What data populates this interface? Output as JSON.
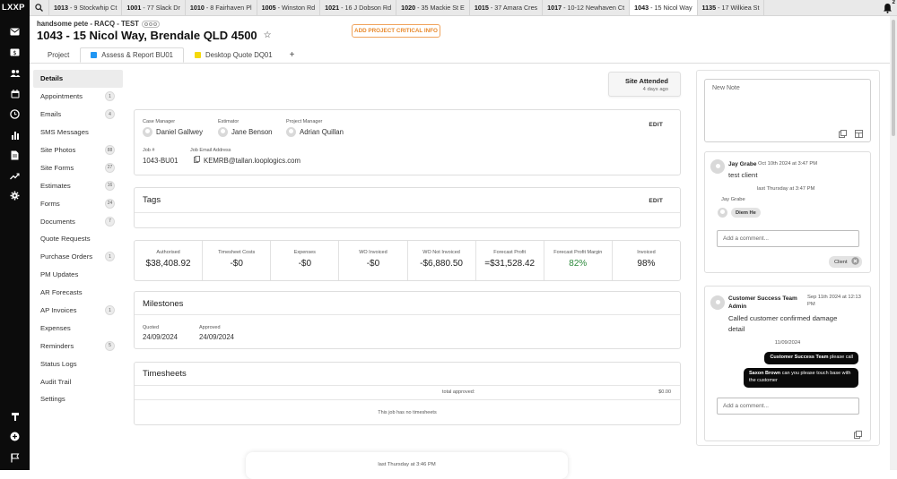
{
  "app": {
    "logo": "LXXP"
  },
  "open_tabs": [
    {
      "num": "1013",
      "label": "- 9 Stockwhip Ct",
      "active": false
    },
    {
      "num": "1001",
      "label": "- 77 Slack Dr",
      "active": false
    },
    {
      "num": "1010",
      "label": "- 8 Fairhaven Pl",
      "active": false
    },
    {
      "num": "1005",
      "label": "- Winston Rd",
      "active": false
    },
    {
      "num": "1021",
      "label": "- 16 J Dobson Rd",
      "active": false
    },
    {
      "num": "1020",
      "label": "- 35 Mackie St E",
      "active": false
    },
    {
      "num": "1015",
      "label": "- 37 Amara Cres",
      "active": false
    },
    {
      "num": "1017",
      "label": "- 10-12 Newhaven Ct",
      "active": false
    },
    {
      "num": "1043",
      "label": "- 15 Nicol Way",
      "active": true
    },
    {
      "num": "1135",
      "label": "- 17 Wilkiea St",
      "active": false
    }
  ],
  "notifications": {
    "count": "2"
  },
  "header": {
    "client": "handsome pete - RACQ - TEST",
    "title": "1043 - 15 Nicol Way, Brendale QLD 4500",
    "critical_button": "ADD PROJECT CRITICAL INFO"
  },
  "subtabs": [
    {
      "label": "Project",
      "color": ""
    },
    {
      "label": "Assess & Report BU01",
      "color": "#2196f3"
    },
    {
      "label": "Desktop Quote DQ01",
      "color": "#f5d90a"
    }
  ],
  "subtab_add": "+",
  "sidenav": [
    {
      "label": "Details",
      "count": ""
    },
    {
      "label": "Appointments",
      "count": "1"
    },
    {
      "label": "Emails",
      "count": "4"
    },
    {
      "label": "SMS Messages",
      "count": ""
    },
    {
      "label": "Site Photos",
      "count": "88"
    },
    {
      "label": "Site Forms",
      "count": "27"
    },
    {
      "label": "Estimates",
      "count": "16"
    },
    {
      "label": "Forms",
      "count": "24"
    },
    {
      "label": "Documents",
      "count": "7"
    },
    {
      "label": "Quote Requests",
      "count": ""
    },
    {
      "label": "Purchase Orders",
      "count": "1"
    },
    {
      "label": "PM Updates",
      "count": ""
    },
    {
      "label": "AR Forecasts",
      "count": ""
    },
    {
      "label": "AP Invoices",
      "count": "1"
    },
    {
      "label": "Expenses",
      "count": ""
    },
    {
      "label": "Reminders",
      "count": "5"
    },
    {
      "label": "Status Logs",
      "count": ""
    },
    {
      "label": "Audit Trail",
      "count": ""
    },
    {
      "label": "Settings",
      "count": ""
    }
  ],
  "site_attended": {
    "title": "Site Attended",
    "sub": "4 days ago"
  },
  "people": {
    "case_manager_label": "Case Manager",
    "case_manager": "Daniel Gallwey",
    "estimator_label": "Estimator",
    "estimator": "Jane Benson",
    "project_manager_label": "Project Manager",
    "project_manager": "Adrian Quillan",
    "job_label": "Job #",
    "job": "1043-BU01",
    "email_label": "Job Email Address",
    "email": "KEMRB@tallan.looplogics.com",
    "edit": "EDIT"
  },
  "tags": {
    "title": "Tags",
    "edit": "EDIT"
  },
  "financials": [
    {
      "label": "Authorised",
      "value": "$38,408.92",
      "green": false
    },
    {
      "label": "Timesheet Costs",
      "value": "-$0",
      "green": false
    },
    {
      "label": "Expenses",
      "value": "-$0",
      "green": false
    },
    {
      "label": "WO Invoiced",
      "value": "-$0",
      "green": false
    },
    {
      "label": "WO Not Invoiced",
      "value": "-$6,880.50",
      "green": false
    },
    {
      "label": "Forecast Profit",
      "value": "=$31,528.42",
      "green": false
    },
    {
      "label": "Forecast Profit Margin",
      "value": "82%",
      "green": true
    },
    {
      "label": "Invoiced",
      "value": "98%",
      "green": false
    }
  ],
  "milestones": {
    "title": "Milestones",
    "quoted_label": "Quoted",
    "quoted": "24/09/2024",
    "approved_label": "Approved",
    "approved": "24/09/2024"
  },
  "timesheets": {
    "title": "Timesheets",
    "total_label": "total approved:",
    "total": "$0.00",
    "empty": "This job has no timesheets"
  },
  "new_note": {
    "placeholder": "New Note"
  },
  "note1": {
    "author": "Jay Grabe",
    "time": "Oct 10th 2024 at 3:47 PM",
    "text": "test client",
    "seen_time": "last Thursday at 3:47 PM",
    "seen_by": "Jay Grabe",
    "mention": "Diem He",
    "comment_placeholder": "Add a comment...",
    "tag": "Client"
  },
  "note2": {
    "author": "Customer Success Team",
    "role": "Admin",
    "time": "Sep 11th 2024 at 12:13 PM",
    "text": "Called customer confirmed damage detail",
    "date_divider": "11/09/2024",
    "reply1_name": "Customer Success Team",
    "reply1_text": "please call",
    "reply2_name": "Saxon Brown",
    "reply2_text": "can you please touch base with the customer",
    "comment_placeholder": "Add a comment..."
  },
  "bottom_toast": {
    "time": "last Thursday at 3:46 PM"
  }
}
